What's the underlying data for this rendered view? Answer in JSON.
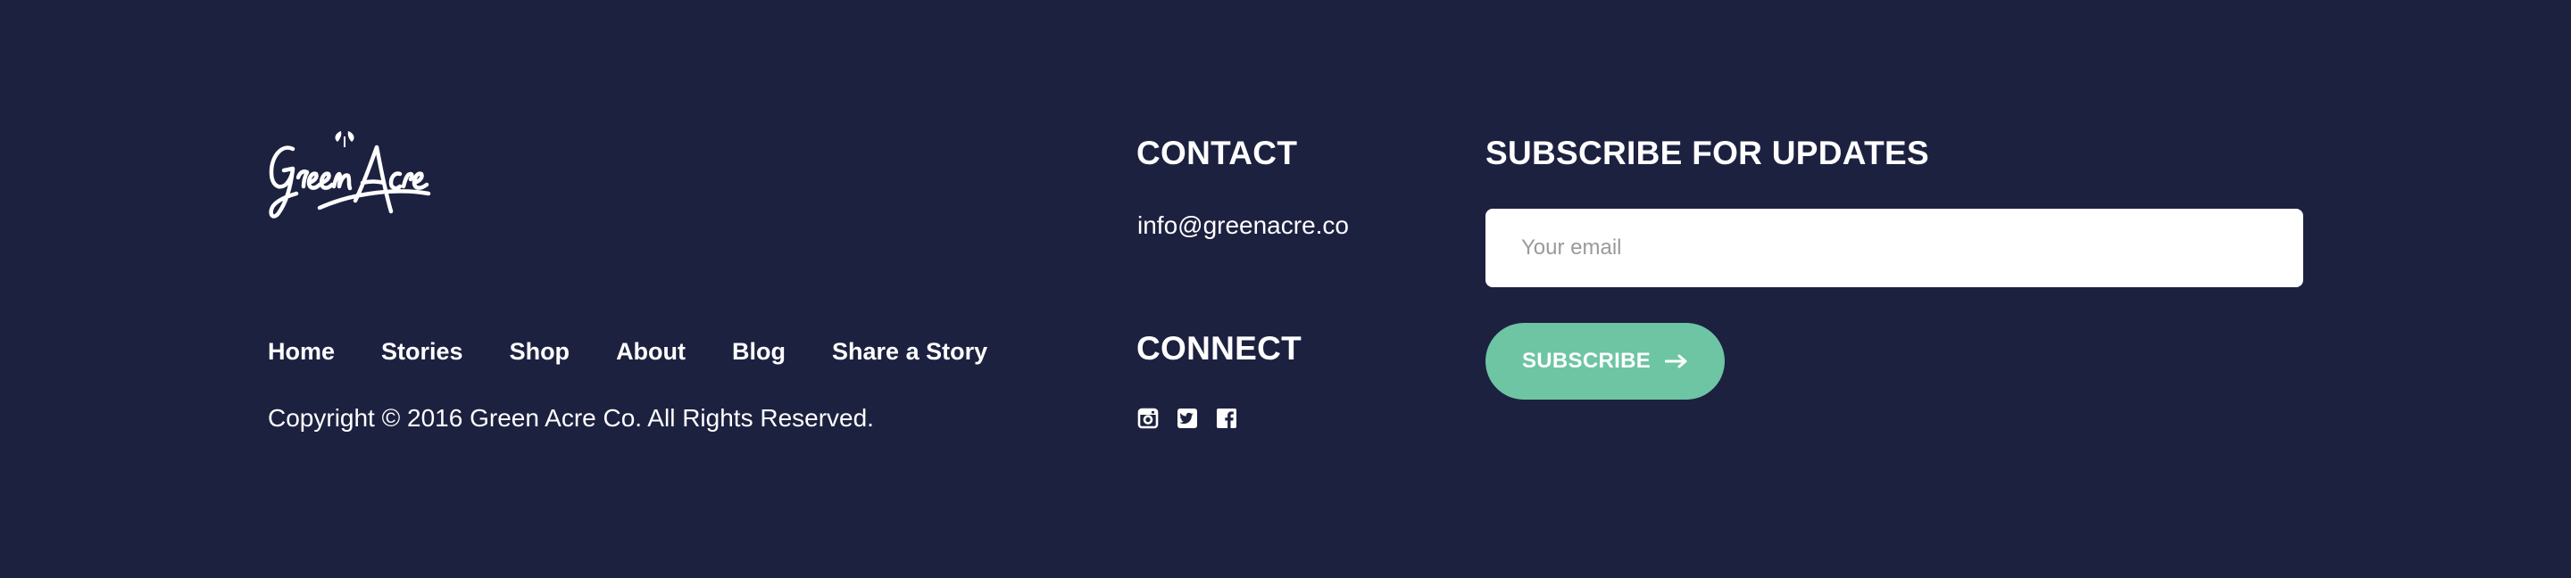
{
  "brand": {
    "logo_text": "GreenAcre"
  },
  "nav": {
    "items": [
      {
        "label": "Home"
      },
      {
        "label": "Stories"
      },
      {
        "label": "Shop"
      },
      {
        "label": "About"
      },
      {
        "label": "Blog"
      },
      {
        "label": "Share a Story"
      }
    ]
  },
  "copyright": "Copyright © 2016 Green Acre Co. All Rights Reserved.",
  "contact": {
    "heading": "CONTACT",
    "email": "info@greenacre.co"
  },
  "connect": {
    "heading": "CONNECT",
    "icons": [
      "instagram-icon",
      "twitter-icon",
      "facebook-icon"
    ]
  },
  "subscribe": {
    "heading": "SUBSCRIBE FOR UPDATES",
    "email_placeholder": "Your email",
    "email_value": "",
    "button_label": "SUBSCRIBE"
  },
  "colors": {
    "background": "#1d2140",
    "accent": "#6dc5a3",
    "text": "#ffffff"
  }
}
